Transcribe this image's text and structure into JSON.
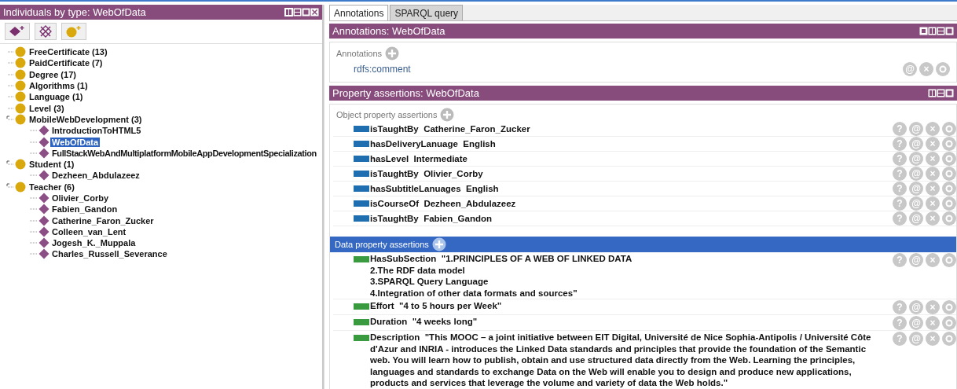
{
  "individuals_panel": {
    "title": "Individuals by type: WebOfData",
    "tree": [
      {
        "kind": "class",
        "label": "FreeCertificate (13)",
        "expanded": false,
        "selected": false
      },
      {
        "kind": "class",
        "label": "PaidCertificate (7)",
        "expanded": false,
        "selected": false
      },
      {
        "kind": "class",
        "label": "Degree (17)",
        "expanded": false,
        "selected": false
      },
      {
        "kind": "class",
        "label": "Algorithms (1)",
        "expanded": false,
        "selected": false
      },
      {
        "kind": "class",
        "label": "Language (1)",
        "expanded": false,
        "selected": false
      },
      {
        "kind": "class",
        "label": "Level (3)",
        "expanded": false,
        "selected": false
      },
      {
        "kind": "class",
        "label": "MobileWebDevelopment (3)",
        "expanded": true,
        "selected": false,
        "children": [
          {
            "kind": "individual",
            "label": "IntroductionToHTML5",
            "selected": false
          },
          {
            "kind": "individual",
            "label": "WebOfData",
            "selected": true
          },
          {
            "kind": "individual",
            "label": "FullStackWebAndMultiplatformMobileAppDevelopmentSpecialization",
            "selected": false
          }
        ]
      },
      {
        "kind": "class",
        "label": "Student (1)",
        "expanded": true,
        "selected": false,
        "children": [
          {
            "kind": "individual",
            "label": "Dezheen_Abdulazeez",
            "selected": false
          }
        ]
      },
      {
        "kind": "class",
        "label": "Teacher (6)",
        "expanded": true,
        "selected": false,
        "children": [
          {
            "kind": "individual",
            "label": "Olivier_Corby",
            "selected": false
          },
          {
            "kind": "individual",
            "label": "Fabien_Gandon",
            "selected": false
          },
          {
            "kind": "individual",
            "label": "Catherine_Faron_Zucker",
            "selected": false
          },
          {
            "kind": "individual",
            "label": "Colleen_van_Lent",
            "selected": false
          },
          {
            "kind": "individual",
            "label": "Jogesh_K._Muppala",
            "selected": false
          },
          {
            "kind": "individual",
            "label": "Charles_Russell_Severance",
            "selected": false
          }
        ]
      }
    ]
  },
  "tabs": [
    {
      "label": "Annotations",
      "selected": true
    },
    {
      "label": "SPARQL query",
      "selected": false
    }
  ],
  "annotations_panel": {
    "title": "Annotations: WebOfData",
    "section_label": "Annotations",
    "items": [
      {
        "property": "rdfs:comment",
        "actions": [
          "@",
          "×"
        ]
      }
    ]
  },
  "property_assertions_panel": {
    "title": "Property assertions: WebOfData",
    "object_section_label": "Object property assertions",
    "object_assertions": [
      {
        "property": "isTaughtBy",
        "value": "Catherine_Faron_Zucker",
        "actions": [
          "?",
          "@",
          "×"
        ]
      },
      {
        "property": "hasDeliveryLanuage",
        "value": "English",
        "actions": [
          "?",
          "@",
          "×"
        ]
      },
      {
        "property": "hasLevel",
        "value": "Intermediate",
        "actions": [
          "?",
          "@",
          "×"
        ]
      },
      {
        "property": "isTaughtBy",
        "value": "Olivier_Corby",
        "actions": [
          "?",
          "@",
          "×"
        ]
      },
      {
        "property": "hasSubtitleLanuages",
        "value": "English",
        "actions": [
          "?",
          "@",
          "×"
        ]
      },
      {
        "property": "isCourseOf",
        "value": "Dezheen_Abdulazeez",
        "actions": [
          "?",
          "@",
          "×"
        ]
      },
      {
        "property": "isTaughtBy",
        "value": "Fabien_Gandon",
        "actions": [
          "?",
          "@",
          "×"
        ]
      }
    ],
    "data_section_label": "Data property assertions",
    "data_assertions": [
      {
        "property": "HasSubSection",
        "value": "\"1.PRINCIPLES OF A WEB OF LINKED DATA\n2.The RDF data model\n3.SPARQL Query Language\n4.Integration of other data formats and sources\"",
        "actions": [
          "?",
          "@",
          "×"
        ]
      },
      {
        "property": "Effort",
        "value": "\"4 to 5 hours per Week\"",
        "actions": [
          "?",
          "@",
          "×"
        ]
      },
      {
        "property": "Duration",
        "value": "\"4 weeks long\"",
        "actions": [
          "?",
          "@",
          "×"
        ]
      },
      {
        "property": "Description",
        "value": "\"This MOOC – a joint initiative between EIT Digital, Université de Nice Sophia-Antipolis / Université Côte d'Azur and INRIA - introduces the Linked Data standards and principles that provide the foundation of the Semantic web. You will learn how to publish, obtain and use structured data directly from the Web. Learning the principles, languages and standards to exchange Data on the Web will enable you to design and produce new applications, products and services that leverage the volume and variety of data the Web holds.\"",
        "actions": [
          "?",
          "@",
          "×"
        ]
      }
    ]
  }
}
